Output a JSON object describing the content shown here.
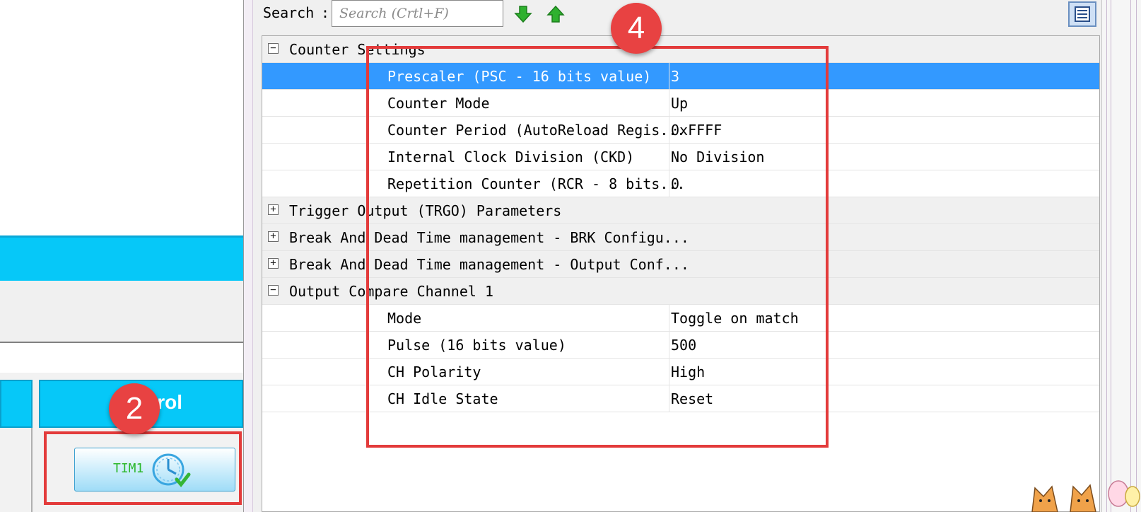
{
  "left_panel": {
    "tab_label_partial": "trol",
    "tim1_button": {
      "label": "TIM1",
      "icon": "clock-check-icon"
    }
  },
  "toolbar": {
    "search_label": "Search",
    "search_colon": ":",
    "search_placeholder": "Search (Crtl+F)",
    "next_icon": "green-arrow-down-icon",
    "prev_icon": "green-arrow-up-icon",
    "view_toggle_icon": "list-view-icon"
  },
  "groups": [
    {
      "name": "Counter Settings",
      "expanded": true,
      "glyph": "−",
      "params": [
        {
          "name": "Prescaler (PSC - 16 bits value)",
          "value": "3",
          "selected": true
        },
        {
          "name": "Counter Mode",
          "value": "Up"
        },
        {
          "name": "Counter Period (AutoReload Regis...",
          "value": "0xFFFF"
        },
        {
          "name": "Internal Clock Division (CKD)",
          "value": "No Division"
        },
        {
          "name": "Repetition Counter (RCR - 8 bits...",
          "value": "0"
        }
      ]
    },
    {
      "name": "Trigger Output (TRGO) Parameters",
      "expanded": false,
      "glyph": "+",
      "params": []
    },
    {
      "name": "Break And Dead Time management - BRK Configu...",
      "expanded": false,
      "glyph": "+",
      "params": []
    },
    {
      "name": "Break And Dead Time management - Output Conf...",
      "expanded": false,
      "glyph": "+",
      "params": []
    },
    {
      "name": "Output Compare Channel 1",
      "expanded": true,
      "glyph": "−",
      "params": [
        {
          "name": "Mode",
          "value": "Toggle on match"
        },
        {
          "name": "Pulse (16 bits value)",
          "value": "500"
        },
        {
          "name": "CH Polarity",
          "value": "High"
        },
        {
          "name": "CH Idle State",
          "value": "Reset"
        }
      ]
    }
  ],
  "annotations": {
    "badge_2": "2",
    "badge_4": "4",
    "color": "#e33b3b"
  },
  "colors": {
    "accent_cyan": "#06c8f8",
    "selection_blue": "#3399ff",
    "tim1_text_green": "#2db82d"
  }
}
